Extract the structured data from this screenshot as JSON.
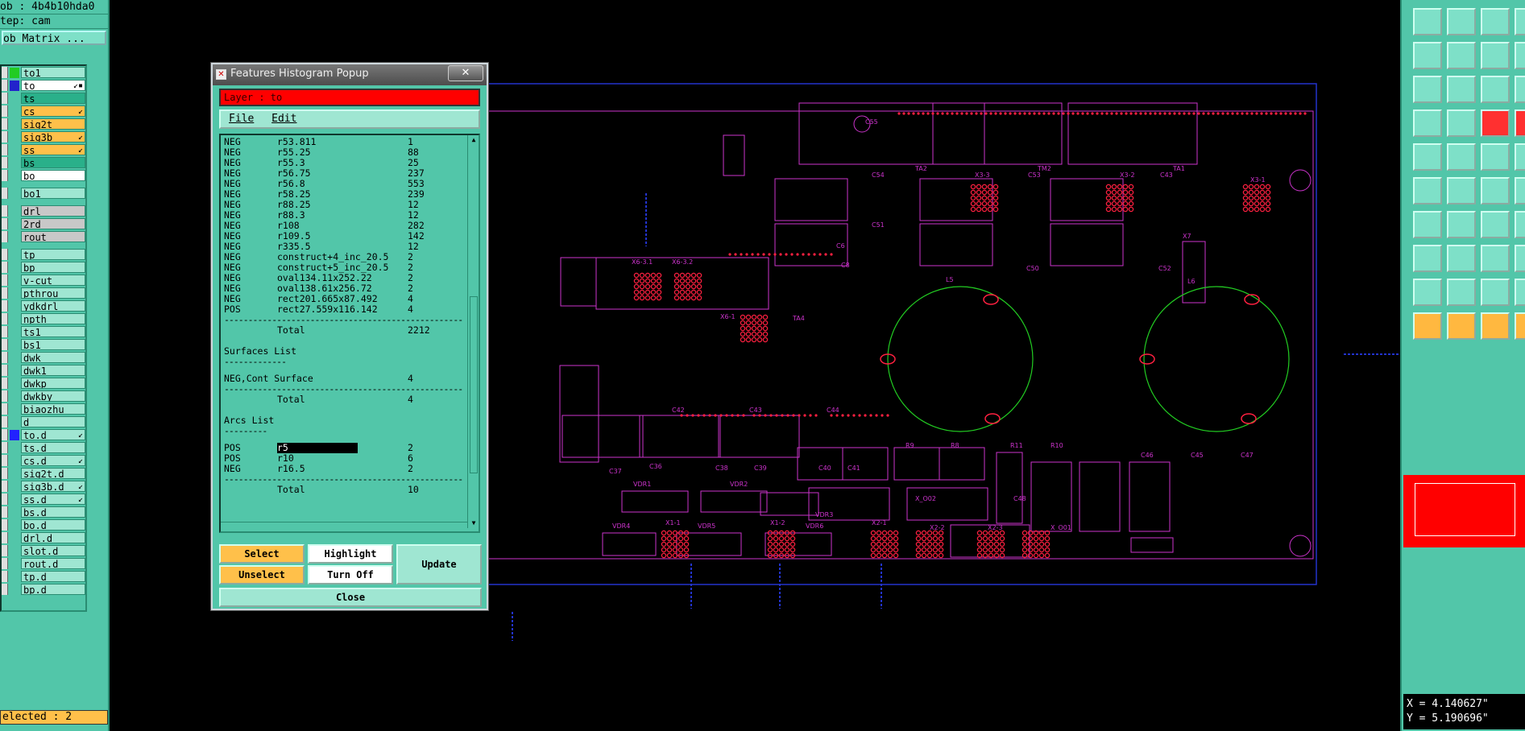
{
  "left_panel": {
    "job_line": "ob : 4b4b10hda0",
    "step_line": "tep: cam",
    "job_matrix_button": "ob Matrix ...",
    "layers": [
      {
        "name": "to1",
        "chip": "#22cc22",
        "hl": "#9fe6d2",
        "mark": ""
      },
      {
        "name": "to",
        "chip": "#2222cc",
        "hl": "#ffffff",
        "mark": "↙▪"
      },
      {
        "name": "ts",
        "chip": "",
        "hl": "#2ab08a",
        "mark": ""
      },
      {
        "name": "cs",
        "chip": "",
        "hl": "#ffc04a",
        "mark": "↙"
      },
      {
        "name": "sig2t",
        "chip": "",
        "hl": "#ffc04a",
        "mark": ""
      },
      {
        "name": "sig3b",
        "chip": "",
        "hl": "#ffc04a",
        "mark": "↙"
      },
      {
        "name": "ss",
        "chip": "",
        "hl": "#ffc04a",
        "mark": "↙"
      },
      {
        "name": "bs",
        "chip": "",
        "hl": "#2ab08a",
        "mark": ""
      },
      {
        "name": "bo",
        "chip": "",
        "hl": "#ffffff",
        "mark": ""
      },
      {
        "sep": true
      },
      {
        "name": "bo1",
        "chip": "",
        "hl": "#9fe6d2",
        "mark": ""
      },
      {
        "sep": true
      },
      {
        "name": "drl",
        "chip": "",
        "hl": "#c8c8c8",
        "mark": ""
      },
      {
        "name": "2rd",
        "chip": "",
        "hl": "#c8c8c8",
        "mark": ""
      },
      {
        "name": "rout",
        "chip": "",
        "hl": "#c8c8c8",
        "mark": ""
      },
      {
        "sep": true
      },
      {
        "name": "tp",
        "chip": "",
        "hl": "#9fe6d2",
        "mark": ""
      },
      {
        "name": "bp",
        "chip": "",
        "hl": "#9fe6d2",
        "mark": ""
      },
      {
        "name": "v-cut",
        "chip": "",
        "hl": "#9fe6d2",
        "mark": ""
      },
      {
        "name": "pthrou",
        "chip": "",
        "hl": "#9fe6d2",
        "mark": ""
      },
      {
        "name": "ydkdrl",
        "chip": "",
        "hl": "#9fe6d2",
        "mark": ""
      },
      {
        "name": "npth",
        "chip": "",
        "hl": "#9fe6d2",
        "mark": ""
      },
      {
        "name": "ts1",
        "chip": "",
        "hl": "#9fe6d2",
        "mark": ""
      },
      {
        "name": "bs1",
        "chip": "",
        "hl": "#9fe6d2",
        "mark": ""
      },
      {
        "name": "dwk",
        "chip": "",
        "hl": "#9fe6d2",
        "mark": ""
      },
      {
        "name": "dwk1",
        "chip": "",
        "hl": "#9fe6d2",
        "mark": ""
      },
      {
        "name": "dwkp",
        "chip": "",
        "hl": "#9fe6d2",
        "mark": ""
      },
      {
        "name": "dwkby",
        "chip": "",
        "hl": "#9fe6d2",
        "mark": ""
      },
      {
        "name": "biaozhu",
        "chip": "",
        "hl": "#9fe6d2",
        "mark": ""
      },
      {
        "name": "d",
        "chip": "",
        "hl": "#9fe6d2",
        "mark": ""
      },
      {
        "name": "to.d",
        "chip": "#2222ff",
        "hl": "#9fe6d2",
        "mark": "↙"
      },
      {
        "name": "ts.d",
        "chip": "",
        "hl": "#9fe6d2",
        "mark": ""
      },
      {
        "name": "cs.d",
        "chip": "",
        "hl": "#9fe6d2",
        "mark": "↙"
      },
      {
        "name": "sig2t.d",
        "chip": "",
        "hl": "#9fe6d2",
        "mark": ""
      },
      {
        "name": "sig3b.d",
        "chip": "",
        "hl": "#9fe6d2",
        "mark": "↙"
      },
      {
        "name": "ss.d",
        "chip": "",
        "hl": "#9fe6d2",
        "mark": "↙"
      },
      {
        "name": "bs.d",
        "chip": "",
        "hl": "#9fe6d2",
        "mark": ""
      },
      {
        "name": "bo.d",
        "chip": "",
        "hl": "#9fe6d2",
        "mark": ""
      },
      {
        "name": "drl.d",
        "chip": "",
        "hl": "#9fe6d2",
        "mark": ""
      },
      {
        "name": "slot.d",
        "chip": "",
        "hl": "#9fe6d2",
        "mark": ""
      },
      {
        "name": "rout.d",
        "chip": "",
        "hl": "#9fe6d2",
        "mark": ""
      },
      {
        "name": "tp.d",
        "chip": "",
        "hl": "#9fe6d2",
        "mark": ""
      },
      {
        "name": "bp.d",
        "chip": "",
        "hl": "#9fe6d2",
        "mark": ""
      }
    ],
    "selected_status": "elected : 2"
  },
  "popup": {
    "title": "Features Histogram Popup",
    "layer_label": "Layer :  to",
    "menu": {
      "file": "File",
      "edit": "Edit"
    },
    "pads": [
      {
        "pol": "NEG",
        "sym": "r53.811",
        "count": "1"
      },
      {
        "pol": "NEG",
        "sym": "r55.25",
        "count": "88"
      },
      {
        "pol": "NEG",
        "sym": "r55.3",
        "count": "25"
      },
      {
        "pol": "NEG",
        "sym": "r56.75",
        "count": "237"
      },
      {
        "pol": "NEG",
        "sym": "r56.8",
        "count": "553"
      },
      {
        "pol": "NEG",
        "sym": "r58.25",
        "count": "239"
      },
      {
        "pol": "NEG",
        "sym": "r88.25",
        "count": "12"
      },
      {
        "pol": "NEG",
        "sym": "r88.3",
        "count": "12"
      },
      {
        "pol": "NEG",
        "sym": "r108",
        "count": "282"
      },
      {
        "pol": "NEG",
        "sym": "r109.5",
        "count": "142"
      },
      {
        "pol": "NEG",
        "sym": "r335.5",
        "count": "12"
      },
      {
        "pol": "NEG",
        "sym": "construct+4_inc_20.5",
        "count": "2"
      },
      {
        "pol": "NEG",
        "sym": "construct+5_inc_20.5",
        "count": "2"
      },
      {
        "pol": "NEG",
        "sym": "oval134.11x252.22",
        "count": "2"
      },
      {
        "pol": "NEG",
        "sym": "oval138.61x256.72",
        "count": "2"
      },
      {
        "pol": "NEG",
        "sym": "rect201.665x87.492",
        "count": "4"
      },
      {
        "pol": "POS",
        "sym": "rect27.559x116.142",
        "count": "4"
      }
    ],
    "pads_total": {
      "label": "Total",
      "value": "2212"
    },
    "surfaces_title": "Surfaces List",
    "surfaces": [
      {
        "pol": "NEG,Cont Surface",
        "sym": "",
        "count": "4"
      }
    ],
    "surfaces_total": {
      "label": "Total",
      "value": "4"
    },
    "arcs_title": "Arcs List",
    "arcs": [
      {
        "pol": "POS",
        "sym": "r5",
        "count": "2"
      },
      {
        "pol": "POS",
        "sym": "r10",
        "count": "6"
      },
      {
        "pol": "NEG",
        "sym": "r16.5",
        "count": "2"
      }
    ],
    "arcs_total": {
      "label": "Total",
      "value": "10"
    },
    "dashes": "--------------------------------------------------",
    "sub_dashes": "-------------",
    "sub_dashes2": "---------",
    "buttons": {
      "select": "Select",
      "highlight": "Highlight",
      "update": "Update",
      "unselect": "Unselect",
      "turn_off": "Turn Off",
      "close": "Close"
    }
  },
  "board_labels": [
    "C55",
    "TA2",
    "TM2",
    "TA1",
    "X3-3",
    "X3-2",
    "X3-1",
    "C54",
    "C53",
    "C43",
    "C51",
    "C50",
    "C52",
    "C6",
    "C8",
    "X6-3.1",
    "X6-3.2",
    "X6-1",
    "TA4",
    "L5",
    "L6",
    "X7",
    "C42",
    "C43",
    "C44",
    "R9",
    "R8",
    "R11",
    "R10",
    "C46",
    "C45",
    "C47",
    "C36",
    "C37",
    "C38",
    "C39",
    "C40",
    "C41",
    "VDR1",
    "VDR2",
    "VDR3",
    "VDR4",
    "VDR5",
    "VDR6",
    "X1-1",
    "X1-2",
    "X2-1",
    "X2-2",
    "X2-3",
    "X_O01",
    "X_O02",
    "C48"
  ],
  "coords": {
    "x": "X = 4.140627\"",
    "y": "Y = 5.190696\""
  },
  "colors": {
    "panel": "#52c6a9",
    "pad": "#ff2040",
    "outline": "#cc33cc",
    "profile": "#2233cc",
    "circle": "#22cc22"
  }
}
